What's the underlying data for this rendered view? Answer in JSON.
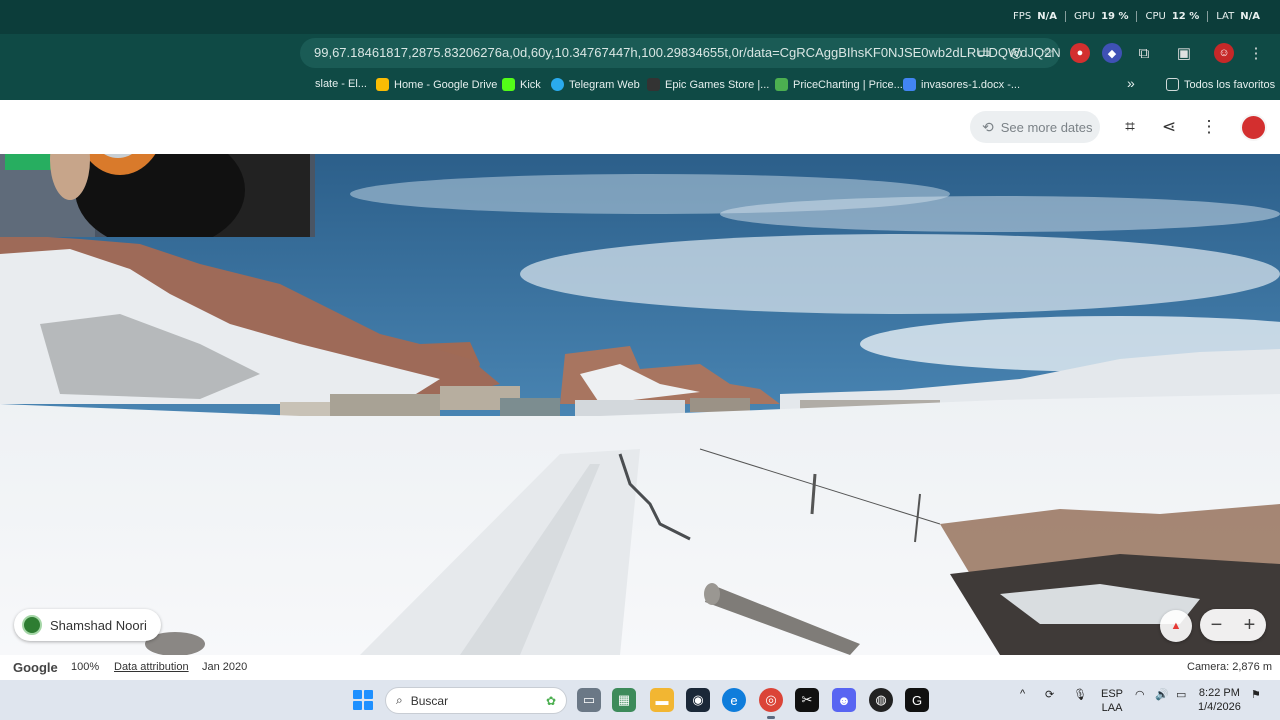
{
  "perf_overlay": [
    {
      "label": "FPS",
      "value": "N/A"
    },
    {
      "label": "GPU",
      "value": "19 %"
    },
    {
      "label": "CPU",
      "value": "12 %"
    },
    {
      "label": "LAT",
      "value": "N/A"
    }
  ],
  "address_bar": {
    "url": "99,67.18461817,2875.83206276a,0d,60y,10.34767447h,100.29834655t,0r/data=CgRCAggBIhsKF0NJSE0wb2dLRUlDQWdJQ2N..."
  },
  "bookmarks": [
    {
      "label": "slate - El...",
      "color": "#1a5b55"
    },
    {
      "label": "Home - Google Drive",
      "color": "#fbbc04"
    },
    {
      "label": "Kick",
      "color": "#53fc18"
    },
    {
      "label": "Telegram Web",
      "color": "#2aabee"
    },
    {
      "label": "Epic Games Store |...",
      "color": "#333333"
    },
    {
      "label": "PriceCharting | Price...",
      "color": "#4caf50"
    },
    {
      "label": "invasores-1.docx -...",
      "color": "#4285f4"
    }
  ],
  "bookmarks_more": "»",
  "all_bookmarks": "Todos los favoritos",
  "maps": {
    "see_more_dates": "See more dates",
    "contributor": "Shamshad Noori",
    "footer": {
      "logo": "Google",
      "zoom": "100%",
      "data_attribution": "Data attribution",
      "date": "Jan 2020",
      "camera": "Camera: 2,876 m"
    },
    "zoom_in": "+",
    "zoom_out": "−"
  },
  "taskbar": {
    "search_placeholder": "Buscar",
    "lang_top": "ESP",
    "lang_bottom": "LAA",
    "time": "8:22 PM",
    "date": "1/4/2026"
  }
}
